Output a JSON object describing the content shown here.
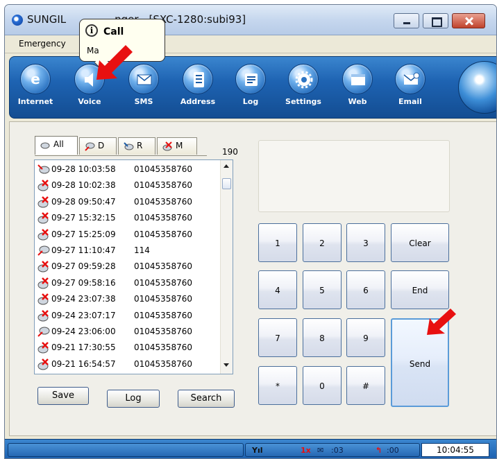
{
  "window": {
    "title_left": "SUNGIL",
    "title_right": "nger - [SXC-1280:subi93]"
  },
  "menu": {
    "items": [
      "Emergency"
    ],
    "hidden_item": "Ma"
  },
  "toolbar": {
    "buttons": [
      {
        "label": "Internet",
        "icon": "internet-icon"
      },
      {
        "label": "Voice",
        "icon": "speaker-icon"
      },
      {
        "label": "SMS",
        "icon": "envelope-icon"
      },
      {
        "label": "Address",
        "icon": "address-book-icon"
      },
      {
        "label": "Log",
        "icon": "log-icon"
      },
      {
        "label": "Settings",
        "icon": "gear-icon"
      },
      {
        "label": "Web",
        "icon": "window-icon"
      },
      {
        "label": "Email",
        "icon": "email-icon"
      }
    ]
  },
  "tooltip": {
    "title": "Call",
    "body": "Ma"
  },
  "tabs": [
    {
      "label": "All",
      "icon": "all-calls-icon"
    },
    {
      "label": "D",
      "icon": "dialed-call-icon"
    },
    {
      "label": "R",
      "icon": "received-call-icon"
    },
    {
      "label": "M",
      "icon": "missed-call-icon"
    }
  ],
  "call_count": "190",
  "call_log": [
    {
      "type": "received",
      "datetime": "09-28 10:03:58",
      "number": "01045358760"
    },
    {
      "type": "missed",
      "datetime": "09-28 10:02:38",
      "number": "01045358760"
    },
    {
      "type": "missed",
      "datetime": "09-28 09:50:47",
      "number": "01045358760"
    },
    {
      "type": "missed",
      "datetime": "09-27 15:32:15",
      "number": "01045358760"
    },
    {
      "type": "missed",
      "datetime": "09-27 15:25:09",
      "number": "01045358760"
    },
    {
      "type": "dialed",
      "datetime": "09-27 11:10:47",
      "number": "114"
    },
    {
      "type": "missed",
      "datetime": "09-27 09:59:28",
      "number": "01045358760"
    },
    {
      "type": "missed",
      "datetime": "09-27 09:58:16",
      "number": "01045358760"
    },
    {
      "type": "missed",
      "datetime": "09-24 23:07:38",
      "number": "01045358760"
    },
    {
      "type": "missed",
      "datetime": "09-24 23:07:17",
      "number": "01045358760"
    },
    {
      "type": "dialed",
      "datetime": "09-24 23:06:00",
      "number": "01045358760"
    },
    {
      "type": "missed",
      "datetime": "09-21 17:30:55",
      "number": "01045358760"
    },
    {
      "type": "missed",
      "datetime": "09-21 16:54:57",
      "number": "01045358760"
    }
  ],
  "buttons": {
    "save": "Save",
    "log": "Log",
    "search": "Search"
  },
  "keypad": {
    "k1": "1",
    "k2": "2",
    "k3": "3",
    "k4": "4",
    "k5": "5",
    "k6": "6",
    "k7": "7",
    "k8": "8",
    "k9": "9",
    "star": "*",
    "k0": "0",
    "hash": "#",
    "clear": "Clear",
    "end": "End",
    "send": "Send"
  },
  "statusbar": {
    "signal": "Yıl",
    "network": "1x",
    "msg_count": ":03",
    "call_count": ":00",
    "time": "10:04:55"
  },
  "colors": {
    "toolbar_blue": "#1e63b2",
    "annotation_red": "#e81010"
  }
}
